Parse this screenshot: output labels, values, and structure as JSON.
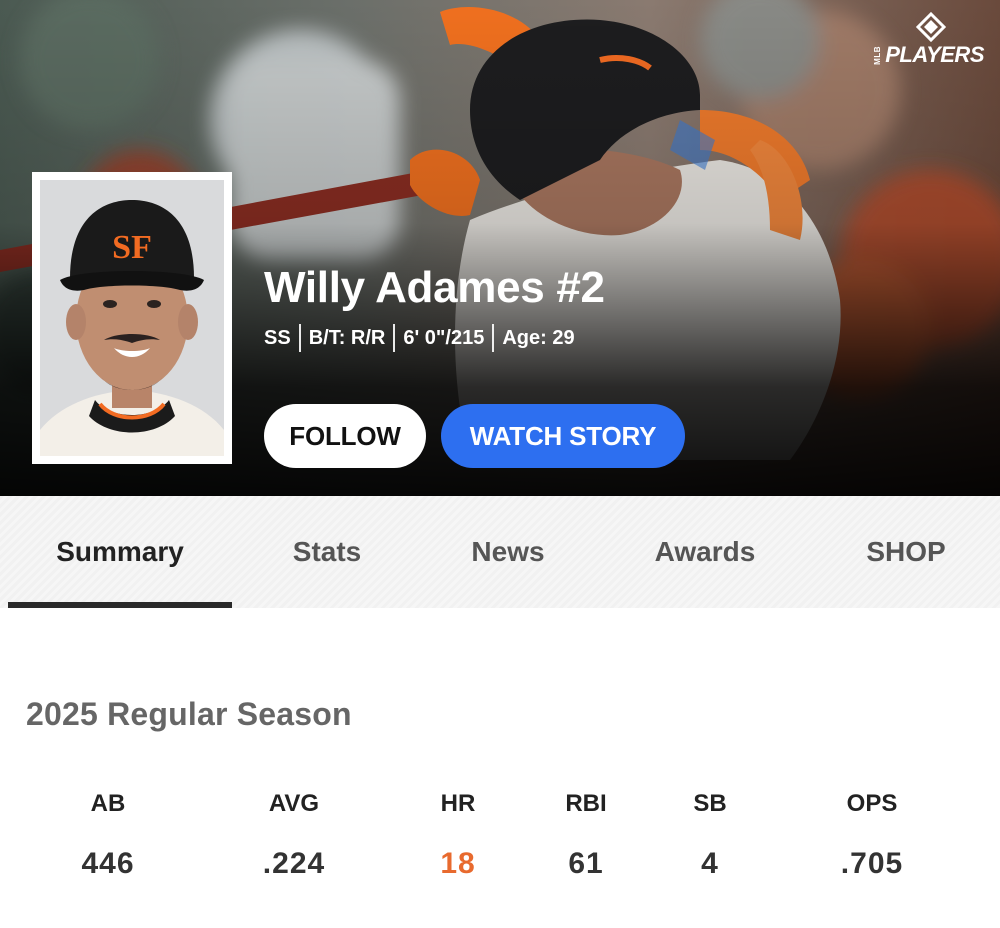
{
  "header": {
    "logo_text": "PLAYERS",
    "logo_sub": "MLB",
    "player_name": "Willy Adames #2",
    "meta": [
      "SS",
      "B/T: R/R",
      "6' 0\"/215",
      "Age: 29"
    ],
    "follow_label": "FOLLOW",
    "watch_label": "WATCH STORY",
    "team_logo": "SF"
  },
  "tabs": [
    "Summary",
    "Stats",
    "News",
    "Awards",
    "SHOP"
  ],
  "active_tab": "Summary",
  "season": {
    "title": "2025 Regular Season",
    "stats": [
      {
        "label": "AB",
        "value": "446"
      },
      {
        "label": "AVG",
        "value": ".224"
      },
      {
        "label": "HR",
        "value": "18"
      },
      {
        "label": "RBI",
        "value": "61"
      },
      {
        "label": "SB",
        "value": "4"
      },
      {
        "label": "OPS",
        "value": ".705"
      }
    ]
  },
  "colors": {
    "watch_button": "#2d6ff0",
    "highlight_stat": "#e86a2e",
    "giants_orange": "#f26b22"
  }
}
